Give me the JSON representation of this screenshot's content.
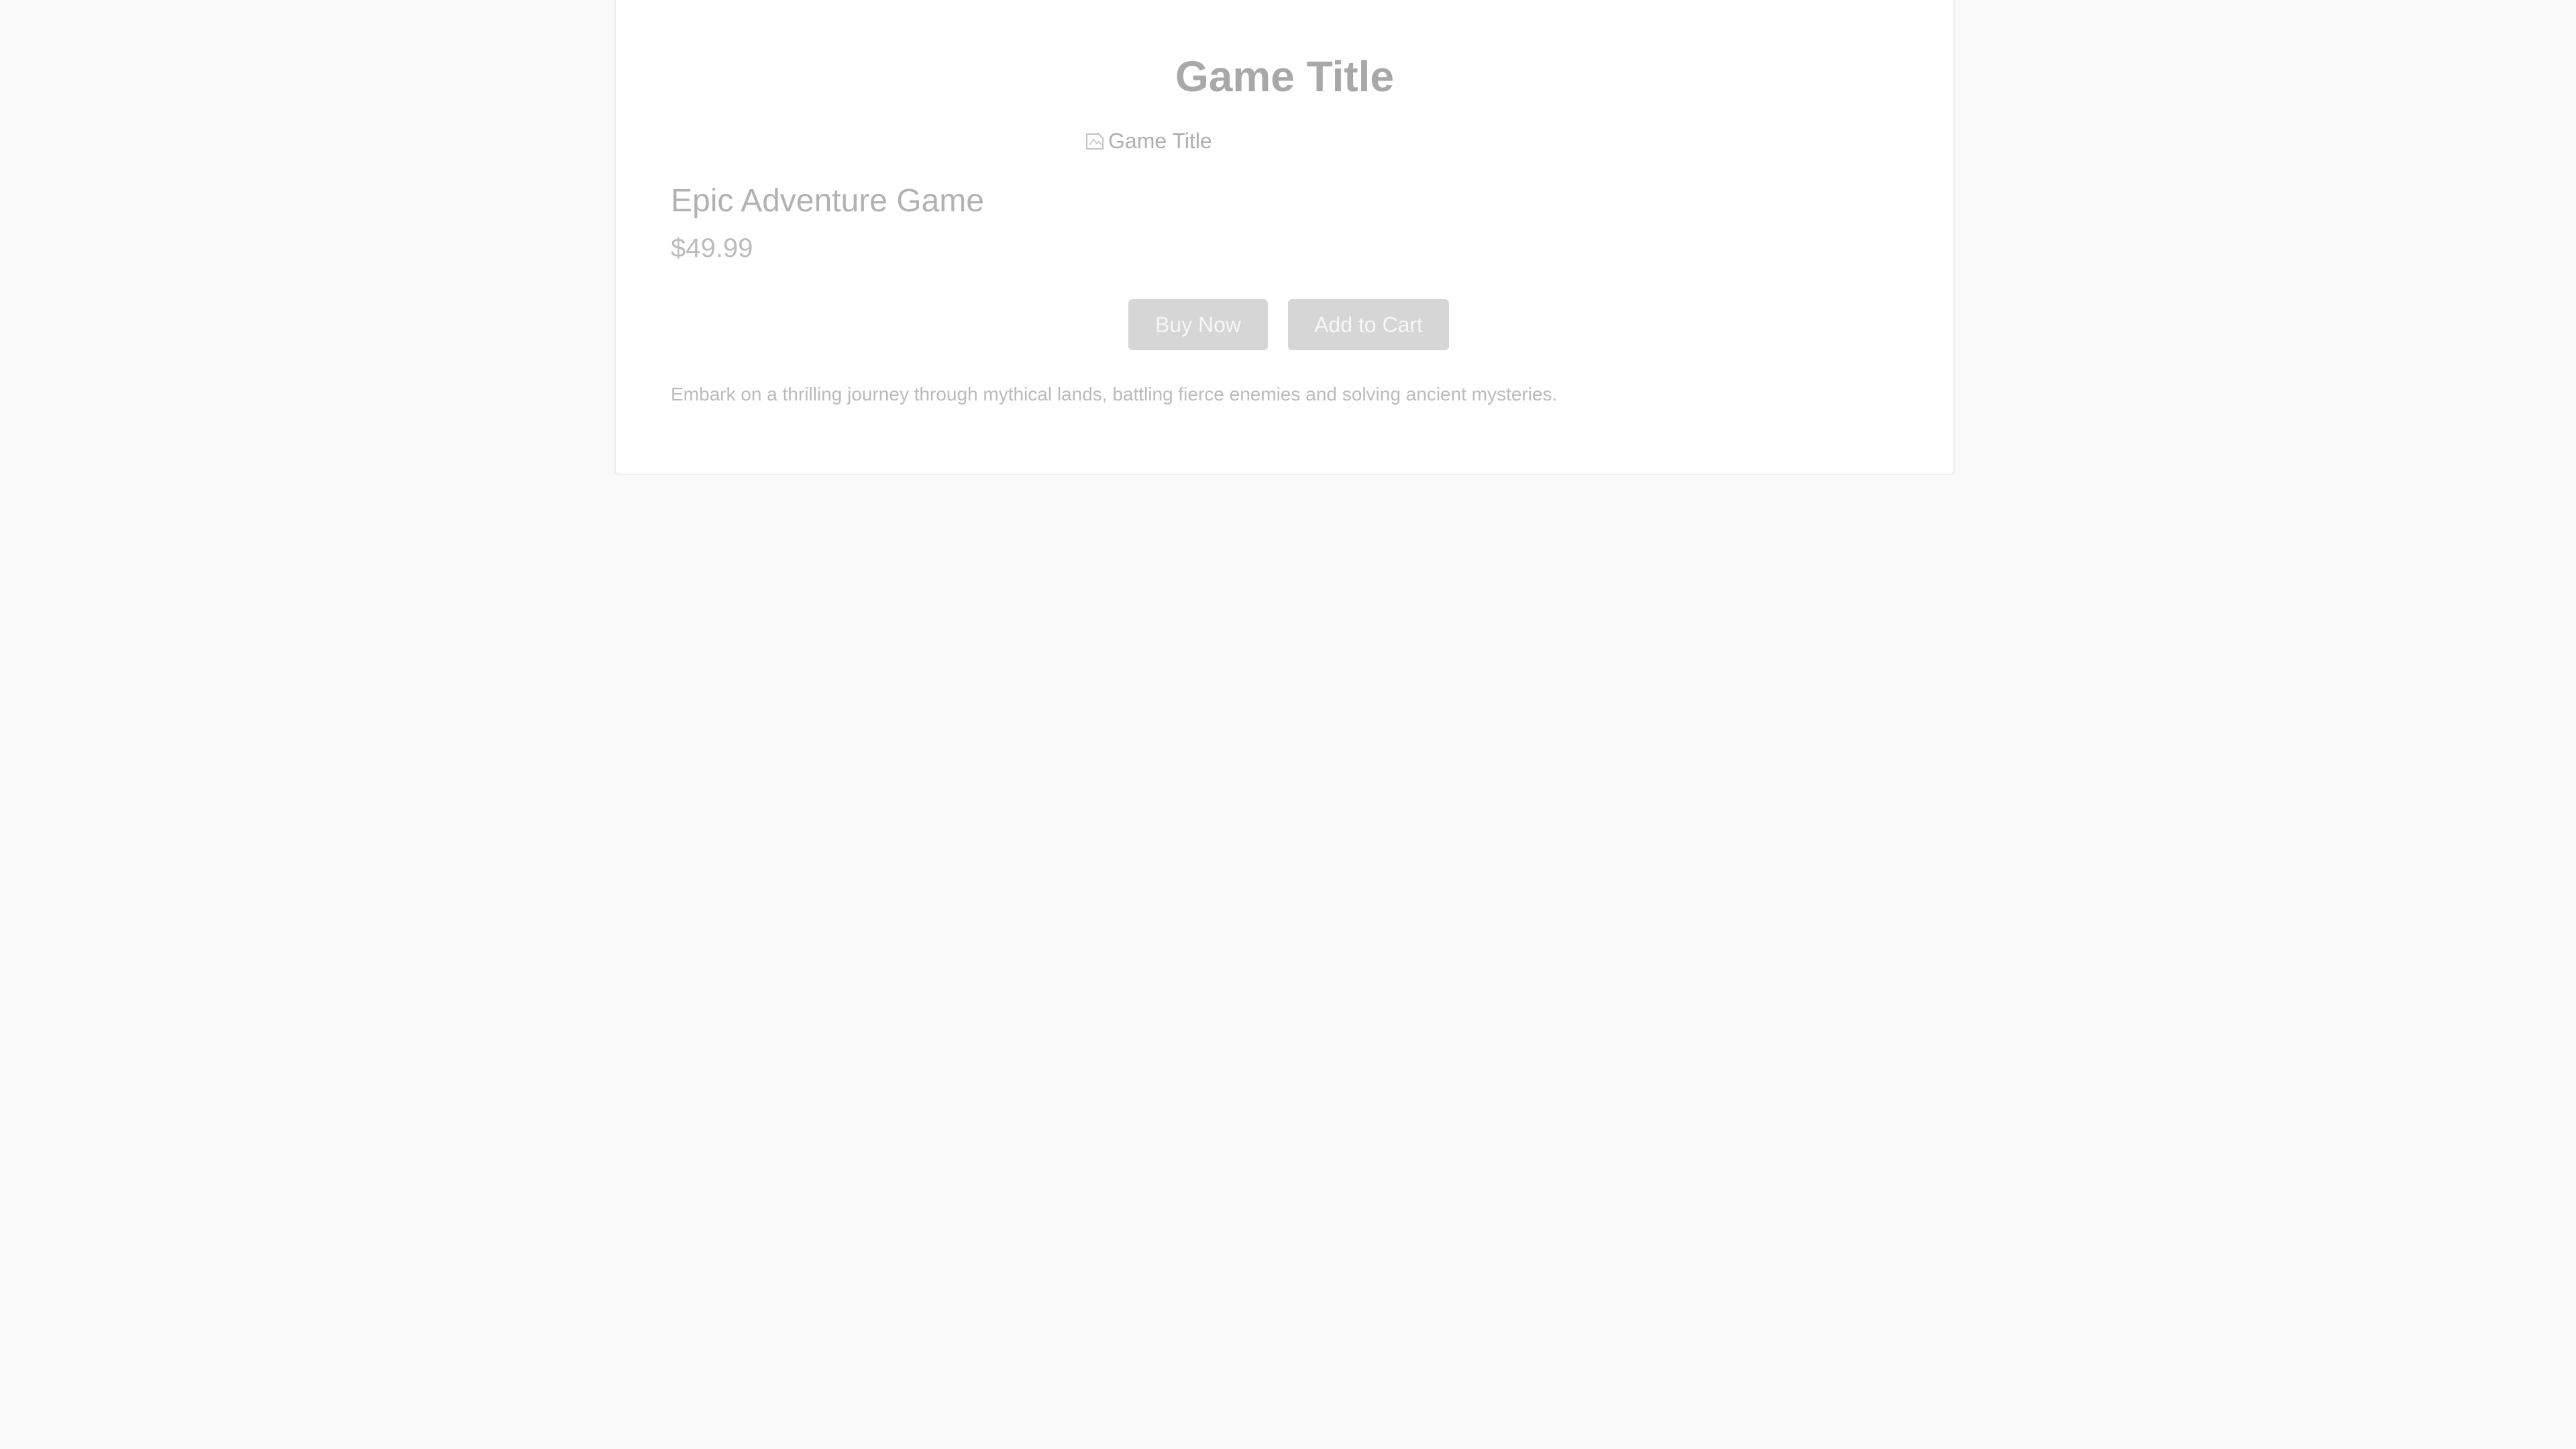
{
  "page": {
    "title": "Game Title"
  },
  "product": {
    "image_alt": "Game Title",
    "image_icon": "broken-image-icon",
    "name": "Epic Adventure Game",
    "price": "$49.99",
    "description": "Embark on a thrilling journey through mythical lands, battling fierce enemies and solving ancient mysteries."
  },
  "actions": {
    "buy_label": "Buy Now",
    "cart_label": "Add to Cart"
  },
  "colors": {
    "background": "#f9f9f9",
    "card": "#ffffff",
    "button": "#d6d6d6",
    "button_text": "#f6f6f6",
    "text_muted": "#a8a8a8"
  }
}
